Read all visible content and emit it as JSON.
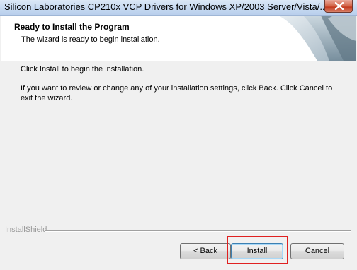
{
  "window": {
    "title": "Silicon Laboratories CP210x VCP Drivers for Windows XP/2003 Server/Vista/..."
  },
  "header": {
    "title": "Ready to Install the Program",
    "subtitle": "The wizard is ready to begin installation."
  },
  "body": {
    "line1": "Click Install to begin the installation.",
    "line2": "If you want to review or change any of your installation settings, click Back. Click Cancel to exit the wizard."
  },
  "footer": {
    "brand": "InstallShield"
  },
  "buttons": {
    "back": "< Back",
    "install": "Install",
    "cancel": "Cancel"
  },
  "colors": {
    "highlight": "#e02020",
    "titlebar": "#c6d9f1",
    "close": "#c33b1f"
  },
  "icons": {
    "close": "close-icon",
    "header_art": "wizard-graphic"
  }
}
